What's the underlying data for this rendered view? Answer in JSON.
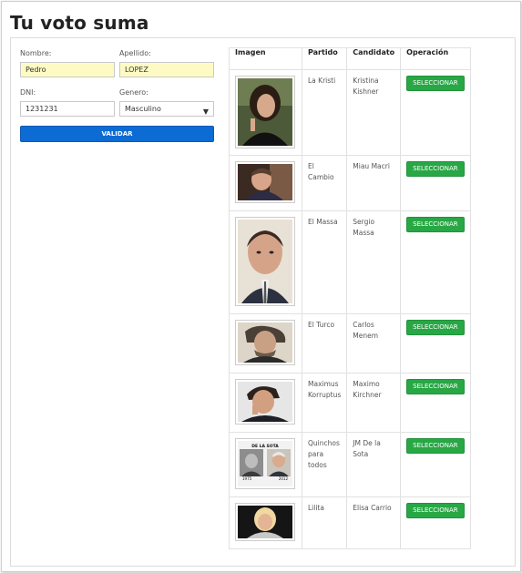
{
  "page": {
    "title": "Tu voto suma"
  },
  "form": {
    "nombre_label": "Nombre:",
    "nombre_value": "Pedro",
    "apellido_label": "Apellido:",
    "apellido_value": "LOPEZ",
    "dni_label": "DNI:",
    "dni_value": "1231231",
    "genero_label": "Genero:",
    "genero_value": "Masculino",
    "validar_label": "VALIDAR"
  },
  "table": {
    "headers": [
      "Imagen",
      "Partido",
      "Candidato",
      "Operación"
    ],
    "select_label": "SELECCIONAR",
    "rows": [
      {
        "partido": "La Kristi",
        "candidato": "Kristina Kishner"
      },
      {
        "partido": "El Cambio",
        "candidato": "Miau Macri"
      },
      {
        "partido": "El Massa",
        "candidato": "Sergio Massa"
      },
      {
        "partido": "El Turco",
        "candidato": "Carlos Menem"
      },
      {
        "partido": "Maximus Korruptus",
        "candidato": "Maximo Kirchner"
      },
      {
        "partido": "Quinchos para todos",
        "candidato": "JM De la Sota",
        "image_caption": "DE LA SOTA",
        "image_years": [
          "1975",
          "2012"
        ]
      },
      {
        "partido": "Lilita",
        "candidato": "Elisa Carrio"
      }
    ]
  },
  "colors": {
    "validate_button": "#0d6bd4",
    "select_button": "#28a745",
    "highlight_field": "#fdfbc3"
  }
}
